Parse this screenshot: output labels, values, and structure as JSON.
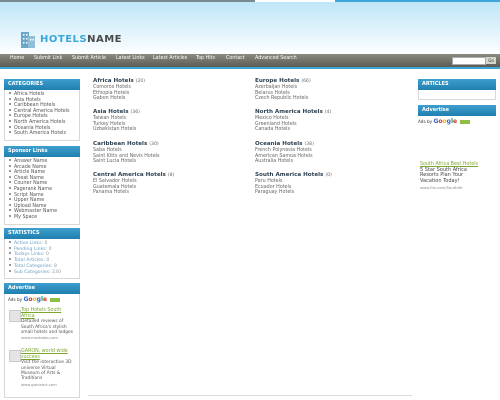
{
  "brand": {
    "word1": "HOTELS",
    "word2": "NAME"
  },
  "nav": [
    "Home",
    "Submit Link",
    "Submit Article",
    "Latest Links",
    "Latest Articles",
    "Top Hits",
    "Contact",
    "Advanced Search"
  ],
  "search": {
    "go_label": "Go"
  },
  "sidebar": {
    "categories_title": "CATEGORIES",
    "categories": [
      "Africa Hotels",
      "Asia Hotels",
      "Caribbean Hotels",
      "Central America Hotels",
      "Europe Hotels",
      "North America Hotels",
      "Oceania Hotels",
      "South America Hotels"
    ],
    "sponsor_title": "Sponsor Links",
    "sponsors": [
      "Answer Name",
      "Arcade Name",
      "Article Name",
      "Cheat Name",
      "Courier Name",
      "Pagerank Name",
      "Script Name",
      "Upper Name",
      "Upload Name",
      "Webmaster Name",
      "My Space"
    ],
    "statistics_title": "STATISTICS",
    "stats": [
      {
        "label": "Active Links:",
        "value": "0"
      },
      {
        "label": "Pending Links:",
        "value": "0"
      },
      {
        "label": "Todays Links:",
        "value": "0"
      },
      {
        "label": "Total Articles:",
        "value": "0"
      },
      {
        "label": "Total Categories:",
        "value": "8"
      },
      {
        "label": "Sub Categories:",
        "value": "230"
      }
    ],
    "advertise_title": "Advertise",
    "ads_by": "Ads by",
    "ads": [
      {
        "title": "Top Hotels South Africa",
        "text": "Detailed reviews of South Africa's stylish small hotels and lodges",
        "url": "www.mezbaba.com"
      },
      {
        "title": "GARON, world wide success",
        "text": "Visit the interactive 3D universe Virtual Museum of Arts & Traditions",
        "url": "www.garonart.com"
      }
    ]
  },
  "google_letters": [
    "G",
    "o",
    "o",
    "g",
    "l",
    "e"
  ],
  "categories": [
    {
      "name": "Africa Hotels",
      "count": "(20)",
      "items": [
        "Comoros Hotels",
        "Ethiopia Hotels",
        "Gabon Hotels"
      ]
    },
    {
      "name": "Europe Hotels",
      "count": "(66)",
      "items": [
        "Azerbaijan Hotels",
        "Belarus Hotels",
        "Czech Republic Hotels"
      ]
    },
    {
      "name": "Asia Hotels",
      "count": "(36)",
      "items": [
        "Taiwan Hotels",
        "Turkey Hotels",
        "Uzbekistan Hotels"
      ]
    },
    {
      "name": "North America Hotels",
      "count": "(4)",
      "items": [
        "Mexico Hotels",
        "Greenland Hotels",
        "Canada Hotels"
      ]
    },
    {
      "name": "Caribbean Hotels",
      "count": "(30)",
      "items": [
        "Saba Hotels",
        "Saint Kitts and Nevis Hotels",
        "Saint Lucia Hotels"
      ]
    },
    {
      "name": "Oceania Hotels",
      "count": "(38)",
      "items": [
        "French Polynesia Hotels",
        "American Samoa Hotels",
        "Australia Hotels"
      ]
    },
    {
      "name": "Central America Hotels",
      "count": "(8)",
      "items": [
        "El Salvador Hotels",
        "Guatemala Hotels",
        "Panama Hotels"
      ]
    },
    {
      "name": "South America Hotels",
      "count": "(0)",
      "items": [
        "Peru Hotels",
        "Ecuador Hotels",
        "Paraguay Hotels"
      ]
    }
  ],
  "right": {
    "articles_title": "ARTICLES",
    "advertise_title": "Advertise",
    "ads_by": "Ads by",
    "ad": {
      "title": "South Africa Best Hotels",
      "text": "5 Star South Africa Resorts Plan Your Vacation Today!",
      "url": "www.fhs.com/SouthAfr"
    }
  }
}
